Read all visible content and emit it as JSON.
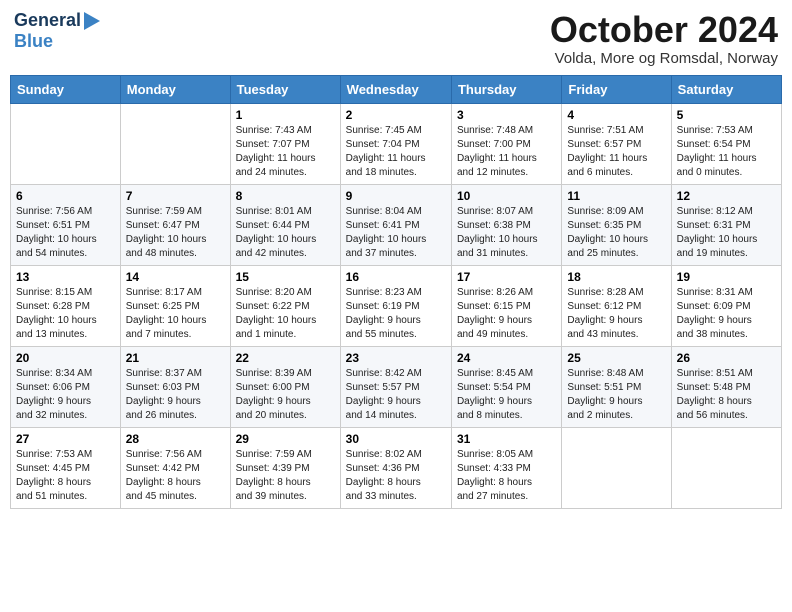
{
  "header": {
    "logo": {
      "general": "General",
      "blue": "Blue"
    },
    "title": "October 2024",
    "location": "Volda, More og Romsdal, Norway"
  },
  "calendar": {
    "days": [
      "Sunday",
      "Monday",
      "Tuesday",
      "Wednesday",
      "Thursday",
      "Friday",
      "Saturday"
    ],
    "weeks": [
      [
        {
          "day": "",
          "info": ""
        },
        {
          "day": "",
          "info": ""
        },
        {
          "day": "1",
          "info": "Sunrise: 7:43 AM\nSunset: 7:07 PM\nDaylight: 11 hours\nand 24 minutes."
        },
        {
          "day": "2",
          "info": "Sunrise: 7:45 AM\nSunset: 7:04 PM\nDaylight: 11 hours\nand 18 minutes."
        },
        {
          "day": "3",
          "info": "Sunrise: 7:48 AM\nSunset: 7:00 PM\nDaylight: 11 hours\nand 12 minutes."
        },
        {
          "day": "4",
          "info": "Sunrise: 7:51 AM\nSunset: 6:57 PM\nDaylight: 11 hours\nand 6 minutes."
        },
        {
          "day": "5",
          "info": "Sunrise: 7:53 AM\nSunset: 6:54 PM\nDaylight: 11 hours\nand 0 minutes."
        }
      ],
      [
        {
          "day": "6",
          "info": "Sunrise: 7:56 AM\nSunset: 6:51 PM\nDaylight: 10 hours\nand 54 minutes."
        },
        {
          "day": "7",
          "info": "Sunrise: 7:59 AM\nSunset: 6:47 PM\nDaylight: 10 hours\nand 48 minutes."
        },
        {
          "day": "8",
          "info": "Sunrise: 8:01 AM\nSunset: 6:44 PM\nDaylight: 10 hours\nand 42 minutes."
        },
        {
          "day": "9",
          "info": "Sunrise: 8:04 AM\nSunset: 6:41 PM\nDaylight: 10 hours\nand 37 minutes."
        },
        {
          "day": "10",
          "info": "Sunrise: 8:07 AM\nSunset: 6:38 PM\nDaylight: 10 hours\nand 31 minutes."
        },
        {
          "day": "11",
          "info": "Sunrise: 8:09 AM\nSunset: 6:35 PM\nDaylight: 10 hours\nand 25 minutes."
        },
        {
          "day": "12",
          "info": "Sunrise: 8:12 AM\nSunset: 6:31 PM\nDaylight: 10 hours\nand 19 minutes."
        }
      ],
      [
        {
          "day": "13",
          "info": "Sunrise: 8:15 AM\nSunset: 6:28 PM\nDaylight: 10 hours\nand 13 minutes."
        },
        {
          "day": "14",
          "info": "Sunrise: 8:17 AM\nSunset: 6:25 PM\nDaylight: 10 hours\nand 7 minutes."
        },
        {
          "day": "15",
          "info": "Sunrise: 8:20 AM\nSunset: 6:22 PM\nDaylight: 10 hours\nand 1 minute."
        },
        {
          "day": "16",
          "info": "Sunrise: 8:23 AM\nSunset: 6:19 PM\nDaylight: 9 hours\nand 55 minutes."
        },
        {
          "day": "17",
          "info": "Sunrise: 8:26 AM\nSunset: 6:15 PM\nDaylight: 9 hours\nand 49 minutes."
        },
        {
          "day": "18",
          "info": "Sunrise: 8:28 AM\nSunset: 6:12 PM\nDaylight: 9 hours\nand 43 minutes."
        },
        {
          "day": "19",
          "info": "Sunrise: 8:31 AM\nSunset: 6:09 PM\nDaylight: 9 hours\nand 38 minutes."
        }
      ],
      [
        {
          "day": "20",
          "info": "Sunrise: 8:34 AM\nSunset: 6:06 PM\nDaylight: 9 hours\nand 32 minutes."
        },
        {
          "day": "21",
          "info": "Sunrise: 8:37 AM\nSunset: 6:03 PM\nDaylight: 9 hours\nand 26 minutes."
        },
        {
          "day": "22",
          "info": "Sunrise: 8:39 AM\nSunset: 6:00 PM\nDaylight: 9 hours\nand 20 minutes."
        },
        {
          "day": "23",
          "info": "Sunrise: 8:42 AM\nSunset: 5:57 PM\nDaylight: 9 hours\nand 14 minutes."
        },
        {
          "day": "24",
          "info": "Sunrise: 8:45 AM\nSunset: 5:54 PM\nDaylight: 9 hours\nand 8 minutes."
        },
        {
          "day": "25",
          "info": "Sunrise: 8:48 AM\nSunset: 5:51 PM\nDaylight: 9 hours\nand 2 minutes."
        },
        {
          "day": "26",
          "info": "Sunrise: 8:51 AM\nSunset: 5:48 PM\nDaylight: 8 hours\nand 56 minutes."
        }
      ],
      [
        {
          "day": "27",
          "info": "Sunrise: 7:53 AM\nSunset: 4:45 PM\nDaylight: 8 hours\nand 51 minutes."
        },
        {
          "day": "28",
          "info": "Sunrise: 7:56 AM\nSunset: 4:42 PM\nDaylight: 8 hours\nand 45 minutes."
        },
        {
          "day": "29",
          "info": "Sunrise: 7:59 AM\nSunset: 4:39 PM\nDaylight: 8 hours\nand 39 minutes."
        },
        {
          "day": "30",
          "info": "Sunrise: 8:02 AM\nSunset: 4:36 PM\nDaylight: 8 hours\nand 33 minutes."
        },
        {
          "day": "31",
          "info": "Sunrise: 8:05 AM\nSunset: 4:33 PM\nDaylight: 8 hours\nand 27 minutes."
        },
        {
          "day": "",
          "info": ""
        },
        {
          "day": "",
          "info": ""
        }
      ]
    ]
  }
}
